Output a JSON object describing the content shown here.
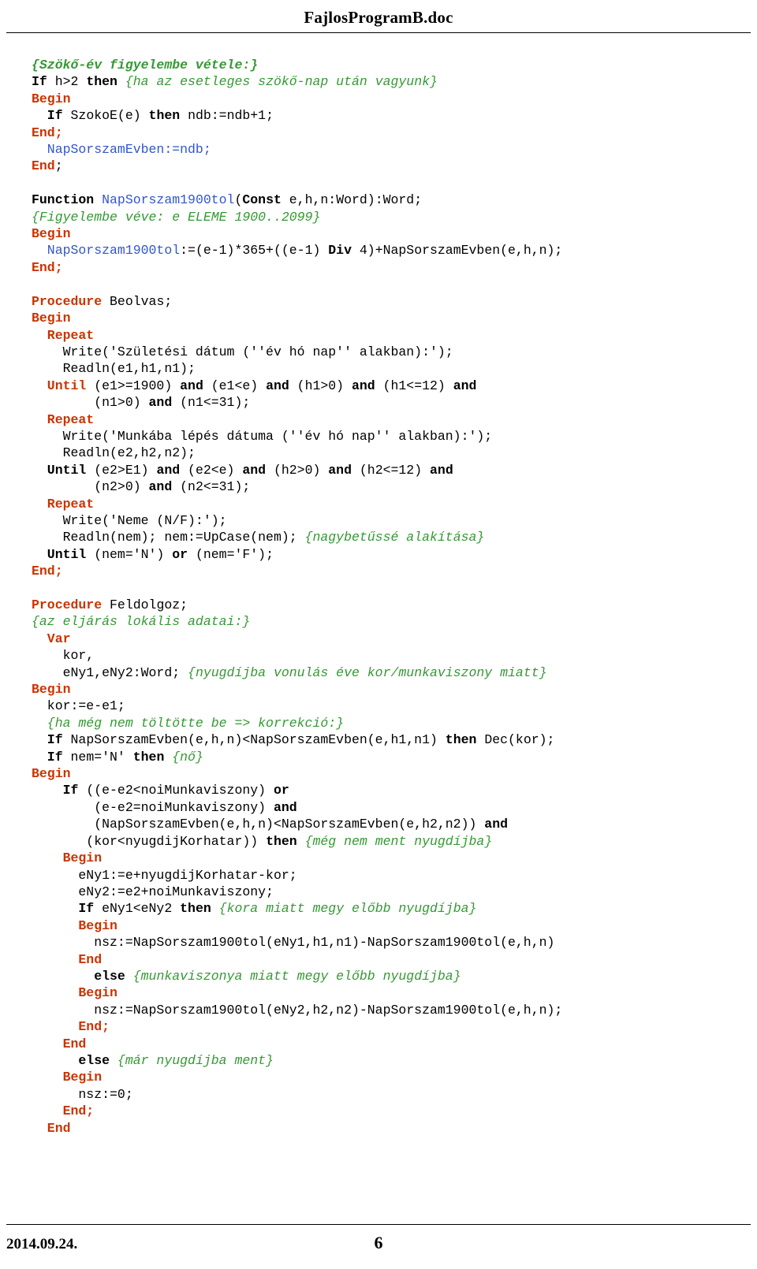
{
  "document": {
    "header_title": "FajlosProgramB.doc",
    "footer_date": "2014.09.24.",
    "footer_page": "6"
  },
  "code_lines": [
    [
      {
        "t": "{Szökő-év figyelembe vétele:}",
        "c": "cmt-b"
      }
    ],
    [
      {
        "t": "If ",
        "c": "kw2"
      },
      {
        "t": "h>2 ",
        "c": "plain"
      },
      {
        "t": "then ",
        "c": "kw2"
      },
      {
        "t": "{ha az esetleges szökő-nap után vagyunk}",
        "c": "cmt"
      }
    ],
    [
      {
        "t": "Begin",
        "c": "kw"
      }
    ],
    [
      {
        "t": "  If ",
        "c": "kw2"
      },
      {
        "t": "SzokoE(e) ",
        "c": "plain"
      },
      {
        "t": "then ",
        "c": "kw2"
      },
      {
        "t": "ndb:=ndb+1;",
        "c": "plain"
      }
    ],
    [
      {
        "t": "End;",
        "c": "kw"
      }
    ],
    [
      {
        "t": "  NapSorszamEvben:=ndb;",
        "c": "id"
      }
    ],
    [
      {
        "t": "End",
        "c": "kw"
      },
      {
        "t": ";",
        "c": "plain"
      }
    ],
    [
      {
        "t": "",
        "c": "plain"
      }
    ],
    [
      {
        "t": "Function ",
        "c": "kw2"
      },
      {
        "t": "NapSorszam1900tol",
        "c": "id"
      },
      {
        "t": "(",
        "c": "plain"
      },
      {
        "t": "Const ",
        "c": "kw2"
      },
      {
        "t": "e,h,n:Word):Word;",
        "c": "plain"
      }
    ],
    [
      {
        "t": "{Figyelembe véve: e ELEME 1900..2099}",
        "c": "cmt"
      }
    ],
    [
      {
        "t": "Begin",
        "c": "kw"
      }
    ],
    [
      {
        "t": "  NapSorszam1900tol",
        "c": "id"
      },
      {
        "t": ":=(e-1)*365+((e-1) ",
        "c": "plain"
      },
      {
        "t": "Div ",
        "c": "kw2"
      },
      {
        "t": "4)+NapSorszamEvben(e,h,n);",
        "c": "plain"
      }
    ],
    [
      {
        "t": "End;",
        "c": "kw"
      }
    ],
    [
      {
        "t": "",
        "c": "plain"
      }
    ],
    [
      {
        "t": "Procedure ",
        "c": "kw"
      },
      {
        "t": "Beolvas;",
        "c": "plain"
      }
    ],
    [
      {
        "t": "Begin",
        "c": "kw"
      }
    ],
    [
      {
        "t": "  Repeat",
        "c": "kw"
      }
    ],
    [
      {
        "t": "    Write('Születési dátum (''év hó nap'' alakban):');",
        "c": "plain"
      }
    ],
    [
      {
        "t": "    Readln(e1,h1,n1);",
        "c": "plain"
      }
    ],
    [
      {
        "t": "  Until ",
        "c": "kw"
      },
      {
        "t": "(e1>=1900) ",
        "c": "plain"
      },
      {
        "t": "and ",
        "c": "kw2"
      },
      {
        "t": "(e1<e) ",
        "c": "plain"
      },
      {
        "t": "and ",
        "c": "kw2"
      },
      {
        "t": "(h1>0) ",
        "c": "plain"
      },
      {
        "t": "and ",
        "c": "kw2"
      },
      {
        "t": "(h1<=12) ",
        "c": "plain"
      },
      {
        "t": "and",
        "c": "kw2"
      }
    ],
    [
      {
        "t": "        (n1>0) ",
        "c": "plain"
      },
      {
        "t": "and ",
        "c": "kw2"
      },
      {
        "t": "(n1<=31);",
        "c": "plain"
      }
    ],
    [
      {
        "t": "  Repeat",
        "c": "kw"
      }
    ],
    [
      {
        "t": "    Write('Munkába lépés dátuma (''év hó nap'' alakban):');",
        "c": "plain"
      }
    ],
    [
      {
        "t": "    Readln(e2,h2,n2);",
        "c": "plain"
      }
    ],
    [
      {
        "t": "  Until ",
        "c": "kw2"
      },
      {
        "t": "(e2>E1) ",
        "c": "plain"
      },
      {
        "t": "and ",
        "c": "kw2"
      },
      {
        "t": "(e2<e) ",
        "c": "plain"
      },
      {
        "t": "and ",
        "c": "kw2"
      },
      {
        "t": "(h2>0) ",
        "c": "plain"
      },
      {
        "t": "and ",
        "c": "kw2"
      },
      {
        "t": "(h2<=12) ",
        "c": "plain"
      },
      {
        "t": "and",
        "c": "kw2"
      }
    ],
    [
      {
        "t": "        (n2>0) ",
        "c": "plain"
      },
      {
        "t": "and ",
        "c": "kw2"
      },
      {
        "t": "(n2<=31);",
        "c": "plain"
      }
    ],
    [
      {
        "t": "  Repeat",
        "c": "kw"
      }
    ],
    [
      {
        "t": "    Write('Neme (N/F):');",
        "c": "plain"
      }
    ],
    [
      {
        "t": "    Readln(nem); nem:=UpCase(nem); ",
        "c": "plain"
      },
      {
        "t": "{nagybetűssé alakítása}",
        "c": "cmt"
      }
    ],
    [
      {
        "t": "  Until ",
        "c": "kw2"
      },
      {
        "t": "(nem='N') ",
        "c": "plain"
      },
      {
        "t": "or ",
        "c": "kw2"
      },
      {
        "t": "(nem='F');",
        "c": "plain"
      }
    ],
    [
      {
        "t": "End;",
        "c": "kw"
      }
    ],
    [
      {
        "t": "",
        "c": "plain"
      }
    ],
    [
      {
        "t": "Procedure ",
        "c": "kw"
      },
      {
        "t": "Feldolgoz;",
        "c": "plain"
      }
    ],
    [
      {
        "t": "{az eljárás lokális adatai:}",
        "c": "cmt"
      }
    ],
    [
      {
        "t": "  Var",
        "c": "kw"
      }
    ],
    [
      {
        "t": "    kor,",
        "c": "plain"
      }
    ],
    [
      {
        "t": "    eNy1,eNy2:Word; ",
        "c": "plain"
      },
      {
        "t": "{nyugdíjba vonulás éve kor/munkaviszony miatt}",
        "c": "cmt"
      }
    ],
    [
      {
        "t": "Begin",
        "c": "kw"
      }
    ],
    [
      {
        "t": "  kor:=e-e1;",
        "c": "plain"
      }
    ],
    [
      {
        "t": "  {ha még nem töltötte be => korrekció:}",
        "c": "cmt"
      }
    ],
    [
      {
        "t": "  If ",
        "c": "kw2"
      },
      {
        "t": "NapSorszamEvben(e,h,n)<NapSorszamEvben(e,h1,n1) ",
        "c": "plain"
      },
      {
        "t": "then ",
        "c": "kw2"
      },
      {
        "t": "Dec(kor);",
        "c": "plain"
      }
    ],
    [
      {
        "t": "  If ",
        "c": "kw2"
      },
      {
        "t": "nem='N' ",
        "c": "plain"
      },
      {
        "t": "then ",
        "c": "kw2"
      },
      {
        "t": "{nő}",
        "c": "cmt"
      }
    ],
    [
      {
        "t": "Begin",
        "c": "kw"
      }
    ],
    [
      {
        "t": "    If ",
        "c": "kw2"
      },
      {
        "t": "((e-e2<noiMunkaviszony) ",
        "c": "plain"
      },
      {
        "t": "or",
        "c": "kw2"
      }
    ],
    [
      {
        "t": "        (e-e2=noiMunkaviszony) ",
        "c": "plain"
      },
      {
        "t": "and",
        "c": "kw2"
      }
    ],
    [
      {
        "t": "        (NapSorszamEvben(e,h,n)<NapSorszamEvben(e,h2,n2)) ",
        "c": "plain"
      },
      {
        "t": "and",
        "c": "kw2"
      }
    ],
    [
      {
        "t": "       (kor<nyugdijKorhatar)) ",
        "c": "plain"
      },
      {
        "t": "then ",
        "c": "kw2"
      },
      {
        "t": "{még nem ment nyugdíjba}",
        "c": "cmt"
      }
    ],
    [
      {
        "t": "    Begin",
        "c": "kw"
      }
    ],
    [
      {
        "t": "      eNy1:=e+nyugdijKorhatar-kor;",
        "c": "plain"
      }
    ],
    [
      {
        "t": "      eNy2:=e2+noiMunkaviszony;",
        "c": "plain"
      }
    ],
    [
      {
        "t": "      If ",
        "c": "kw2"
      },
      {
        "t": "eNy1<eNy2 ",
        "c": "plain"
      },
      {
        "t": "then ",
        "c": "kw2"
      },
      {
        "t": "{kora miatt megy előbb nyugdíjba}",
        "c": "cmt"
      }
    ],
    [
      {
        "t": "      Begin",
        "c": "kw"
      }
    ],
    [
      {
        "t": "        nsz:=NapSorszam1900tol(eNy1,h1,n1)-NapSorszam1900tol(e,h,n)",
        "c": "plain"
      }
    ],
    [
      {
        "t": "      End",
        "c": "kw"
      }
    ],
    [
      {
        "t": "        else ",
        "c": "kw2"
      },
      {
        "t": "{munkaviszonya miatt megy előbb nyugdíjba}",
        "c": "cmt"
      }
    ],
    [
      {
        "t": "      Begin",
        "c": "kw"
      }
    ],
    [
      {
        "t": "        nsz:=NapSorszam1900tol(eNy2,h2,n2)-NapSorszam1900tol(e,h,n);",
        "c": "plain"
      }
    ],
    [
      {
        "t": "      End;",
        "c": "kw"
      }
    ],
    [
      {
        "t": "    End",
        "c": "kw"
      }
    ],
    [
      {
        "t": "      else ",
        "c": "kw2"
      },
      {
        "t": "{már nyugdíjba ment}",
        "c": "cmt"
      }
    ],
    [
      {
        "t": "    Begin",
        "c": "kw"
      }
    ],
    [
      {
        "t": "      nsz:=0;",
        "c": "plain"
      }
    ],
    [
      {
        "t": "    End;",
        "c": "kw"
      }
    ],
    [
      {
        "t": "  End",
        "c": "kw"
      }
    ]
  ]
}
